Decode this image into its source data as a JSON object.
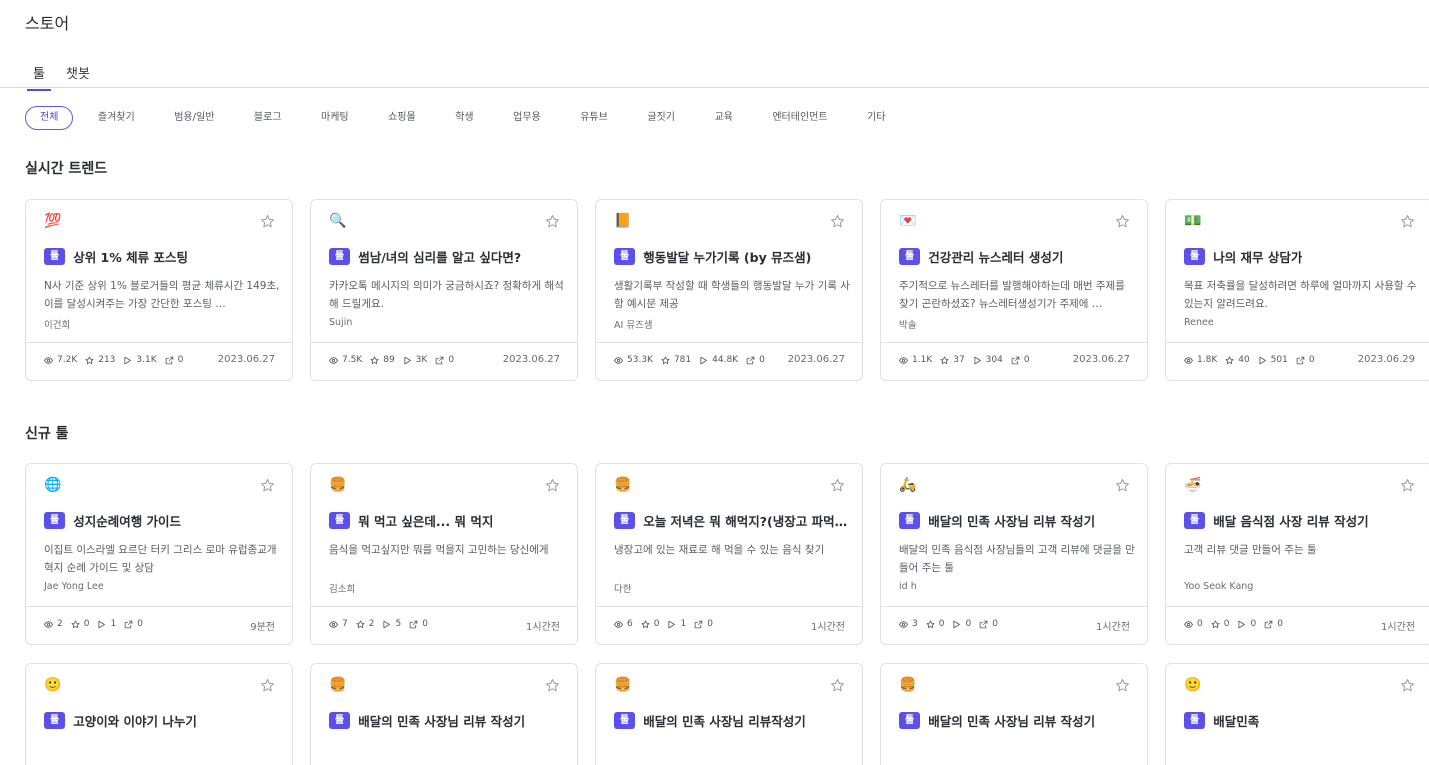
{
  "page_title": "스토어",
  "tabs": [
    {
      "label": "툴",
      "active": true
    },
    {
      "label": "챗봇",
      "active": false
    }
  ],
  "categories": [
    "전체",
    "즐겨찾기",
    "범용/일반",
    "블로그",
    "마케팅",
    "쇼핑몰",
    "학생",
    "업무용",
    "유튜브",
    "글짓기",
    "교육",
    "엔터테인먼트",
    "기타"
  ],
  "active_category": "전체",
  "badge_label": "툴",
  "accent_color": "#5b50e8",
  "sections": [
    {
      "title": "실시간 트렌드",
      "cards": [
        {
          "emoji": "💯",
          "title": "상위 1% 체류 포스팅",
          "desc": "N사 기준 상위 1% 블로거들의 평균 체류시간 149초, 이를 달성시켜주는 가장 간단한 포스팅 …",
          "author": "이건희",
          "views": "7.2K",
          "stars": "213",
          "runs": "3.1K",
          "shares": "0",
          "date": "2023.06.27"
        },
        {
          "emoji": "🔍",
          "title": "썸남/녀의 심리를 알고 싶다면?",
          "desc": "카카오톡 메시지의 의미가 궁금하시죠? 정확하게 해석해 드릴게요.",
          "author": "Sujin",
          "views": "7.5K",
          "stars": "89",
          "runs": "3K",
          "shares": "0",
          "date": "2023.06.27"
        },
        {
          "emoji": "📙",
          "title": "행동발달 누가기록 (by 뮤즈샘)",
          "desc": "생활기록부 작성할 때 학생들의 행동발달 누가 기록 사항 예시문 제공",
          "author": "AI 뮤즈샘",
          "views": "53.3K",
          "stars": "781",
          "runs": "44.8K",
          "shares": "0",
          "date": "2023.06.27"
        },
        {
          "emoji": "💌",
          "title": "건강관리 뉴스레터 생성기",
          "desc": "주기적으로 뉴스레터를 발행해야하는데 매번 주제를 찾기 곤란하셨죠? 뉴스레터생성기가 주제에 …",
          "author": "박솔",
          "views": "1.1K",
          "stars": "37",
          "runs": "304",
          "shares": "0",
          "date": "2023.06.27"
        },
        {
          "emoji": "💵",
          "title": "나의 재무 상담가",
          "desc": "목표 저축률을 달성하려면 하루에 얼마까지 사용할 수 있는지 알려드려요.",
          "author": "Renee",
          "views": "1.8K",
          "stars": "40",
          "runs": "501",
          "shares": "0",
          "date": "2023.06.29"
        }
      ]
    },
    {
      "title": "신규 툴",
      "cards": [
        {
          "emoji": "🌐",
          "title": "성지순례여행 가이드",
          "desc": "이집트 이스라엘 요르단 터키 그리스 로마 유럽종교개혁지 순례 가이드 및 상담",
          "author": "Jae Yong Lee",
          "views": "2",
          "stars": "0",
          "runs": "1",
          "shares": "0",
          "date": "9분전"
        },
        {
          "emoji": "🍔",
          "title": "뭐 먹고 싶은데... 뭐 먹지",
          "desc": "음식을 먹고싶지만 뭐를 먹을지 고민하는 당신에게",
          "author": "김소희",
          "views": "7",
          "stars": "2",
          "runs": "5",
          "shares": "0",
          "date": "1시간전"
        },
        {
          "emoji": "🍔",
          "title": "오늘 저녁은 뭐 해먹지?(냉장고 파먹기)",
          "desc": "냉장고에 있는 재료로 해 먹을 수 있는 음식 찾기",
          "author": "다한",
          "views": "6",
          "stars": "0",
          "runs": "1",
          "shares": "0",
          "date": "1시간전"
        },
        {
          "emoji": "🛵",
          "title": "배달의 민족 사장님 리뷰 작성기",
          "desc": "배달의 민족 음식점 사장님들의 고객 리뷰에 댓글을 만들어 주는 툴",
          "author": "id h",
          "views": "3",
          "stars": "0",
          "runs": "0",
          "shares": "0",
          "date": "1시간전"
        },
        {
          "emoji": "🍜",
          "title": "배달 음식점 사장 리뷰 작성기",
          "desc": "고객 리뷰 댓글 만들어 주는 툴",
          "author": "Yoo Seok Kang",
          "views": "0",
          "stars": "0",
          "runs": "0",
          "shares": "0",
          "date": "1시간전"
        }
      ]
    },
    {
      "title": "",
      "cards": [
        {
          "emoji": "🙂",
          "title": "고양이와 이야기 나누기"
        },
        {
          "emoji": "🍔",
          "title": "배달의 민족 사장님 리뷰 작성기"
        },
        {
          "emoji": "🍔",
          "title": "배달의 민족 사장님 리뷰작성기"
        },
        {
          "emoji": "🍔",
          "title": "배달의 민족 사장님 리뷰 작성기"
        },
        {
          "emoji": "🙂",
          "title": "배달민족"
        }
      ]
    }
  ]
}
